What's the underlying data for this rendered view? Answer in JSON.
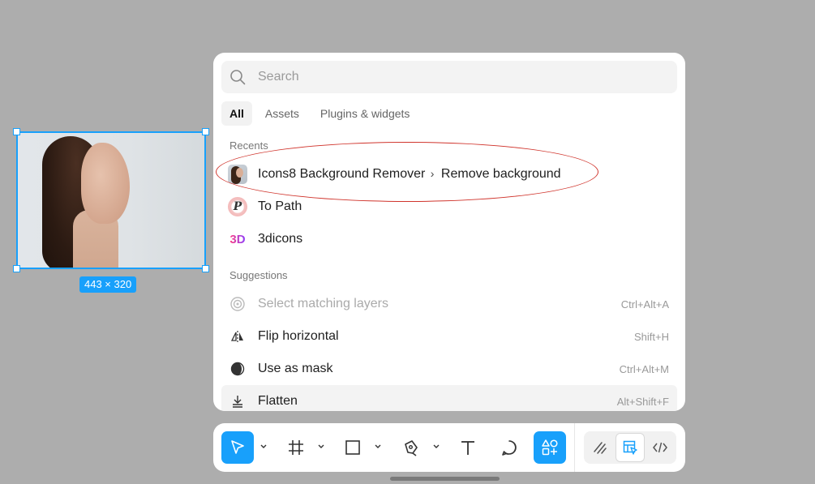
{
  "canvas": {
    "size_label": "443 × 320"
  },
  "search": {
    "placeholder": "Search",
    "value": ""
  },
  "tabs": [
    {
      "label": "All",
      "active": true
    },
    {
      "label": "Assets",
      "active": false
    },
    {
      "label": "Plugins & widgets",
      "active": false
    }
  ],
  "recents": {
    "title": "Recents",
    "items": [
      {
        "label": "Icons8 Background Remover",
        "sub": "Remove background",
        "icon": "plugin-thumbnail-icon"
      },
      {
        "label": "To Path",
        "icon": "to-path-icon"
      },
      {
        "label": "3dicons",
        "icon": "3dicons-icon",
        "glyph": "3D"
      }
    ]
  },
  "suggestions": {
    "title": "Suggestions",
    "items": [
      {
        "label": "Select matching layers",
        "shortcut": "Ctrl+Alt+A",
        "icon": "target-icon",
        "disabled": true
      },
      {
        "label": "Flip horizontal",
        "shortcut": "Shift+H",
        "icon": "flip-horizontal-icon"
      },
      {
        "label": "Use as mask",
        "shortcut": "Ctrl+Alt+M",
        "icon": "mask-icon"
      },
      {
        "label": "Flatten",
        "shortcut": "Alt+Shift+F",
        "icon": "flatten-icon"
      }
    ]
  },
  "topath_glyph": "P",
  "colors": {
    "accent": "#18a0fb",
    "annotation": "#d0342c"
  }
}
